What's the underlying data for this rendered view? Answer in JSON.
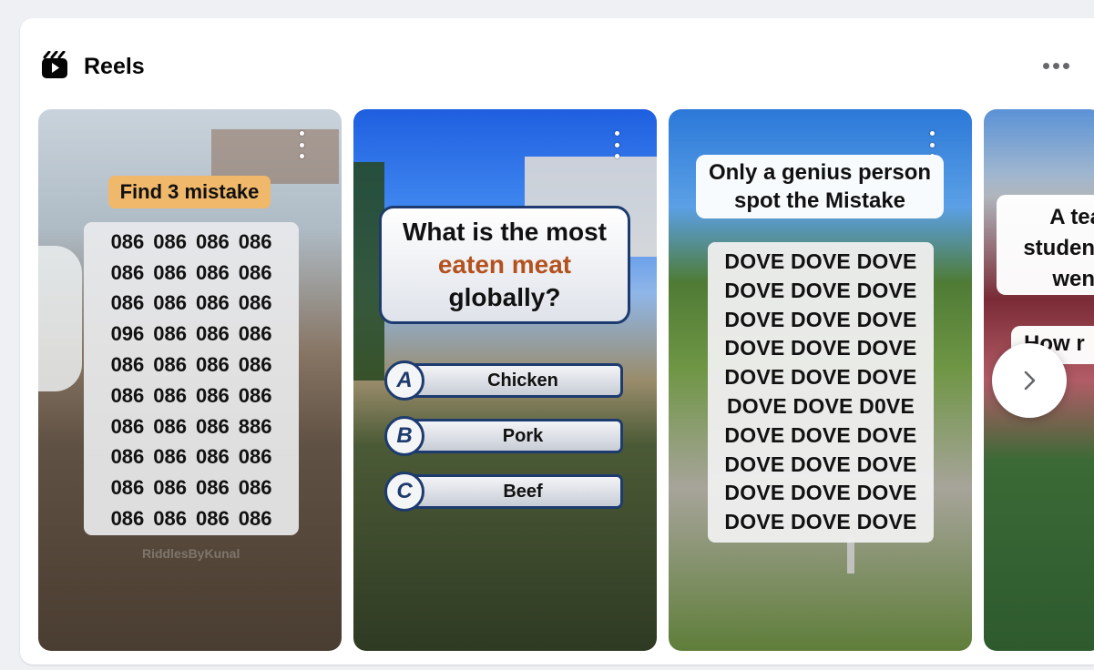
{
  "section": {
    "title": "Reels",
    "icon": "reels-icon",
    "more_icon": "more-horizontal-icon"
  },
  "reels": [
    {
      "tag": "Find 3 mistake",
      "grid": [
        [
          "086",
          "086",
          "086",
          "086"
        ],
        [
          "086",
          "086",
          "086",
          "086"
        ],
        [
          "086",
          "086",
          "086",
          "086"
        ],
        [
          "096",
          "086",
          "086",
          "086"
        ],
        [
          "086",
          "086",
          "086",
          "086"
        ],
        [
          "086",
          "086",
          "086",
          "086"
        ],
        [
          "086",
          "086",
          "086",
          "886"
        ],
        [
          "086",
          "086",
          "086",
          "086"
        ],
        [
          "086",
          "086",
          "086",
          "086"
        ],
        [
          "086",
          "086",
          "086",
          "086"
        ]
      ],
      "watermark": "RiddlesByKunal"
    },
    {
      "question_lines": [
        "What is the most",
        "eaten meat",
        "globally?"
      ],
      "options": [
        {
          "letter": "A",
          "label": "Chicken"
        },
        {
          "letter": "B",
          "label": "Pork"
        },
        {
          "letter": "C",
          "label": "Beef"
        }
      ]
    },
    {
      "tag_lines": [
        "Only a genius person",
        "spot the Mistake"
      ],
      "grid": [
        "DOVE DOVE DOVE",
        "DOVE DOVE DOVE",
        "DOVE DOVE DOVE",
        "DOVE DOVE DOVE",
        "DOVE DOVE DOVE",
        "DOVE DOVE D0VE",
        "DOVE DOVE DOVE",
        "DOVE DOVE DOVE",
        "DOVE DOVE DOVE",
        "DOVE DOVE DOVE"
      ]
    },
    {
      "tag_lines": [
        "A tea",
        "student",
        "went"
      ],
      "tag2": "How r"
    }
  ],
  "next_icon": "chevron-right-icon",
  "colors": {
    "card_bg": "#ffffff",
    "page_bg": "#eef0f3",
    "text": "#050505",
    "icon_grey": "#65676b",
    "quiz_border": "#1d3b6e",
    "quiz_highlight": "#b4521f",
    "tag_orange": "#efb86a"
  }
}
